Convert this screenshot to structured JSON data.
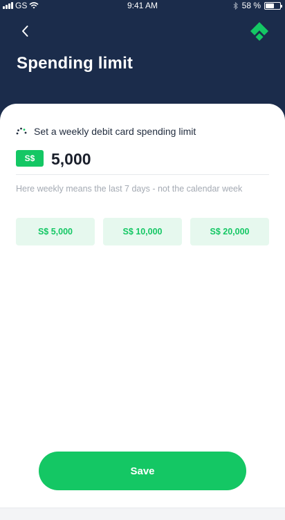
{
  "status_bar": {
    "carrier": "GS",
    "time": "9:41 AM",
    "battery_percent": "58 %",
    "battery_level": 0.58,
    "icons": [
      "signal-icon",
      "wifi-icon",
      "bluetooth-icon",
      "battery-icon"
    ]
  },
  "header": {
    "title": "Spending limit",
    "back_icon": "chevron-left-icon",
    "logo_icon": "brand-logo-icon"
  },
  "limit": {
    "label": "Set a weekly debit card spending limit",
    "icon": "gauge-icon",
    "currency": "S$",
    "amount": "5,000",
    "hint": "Here weekly means the last 7 days - not the calendar week"
  },
  "presets": [
    {
      "label": "S$ 5,000"
    },
    {
      "label": "S$ 10,000"
    },
    {
      "label": "S$ 20,000"
    }
  ],
  "save_label": "Save",
  "colors": {
    "header_bg": "#1b2c4b",
    "accent": "#14c764",
    "preset_bg": "#e6f8ee",
    "text_dark": "#1f2a3c",
    "hint": "#a4aab3"
  }
}
